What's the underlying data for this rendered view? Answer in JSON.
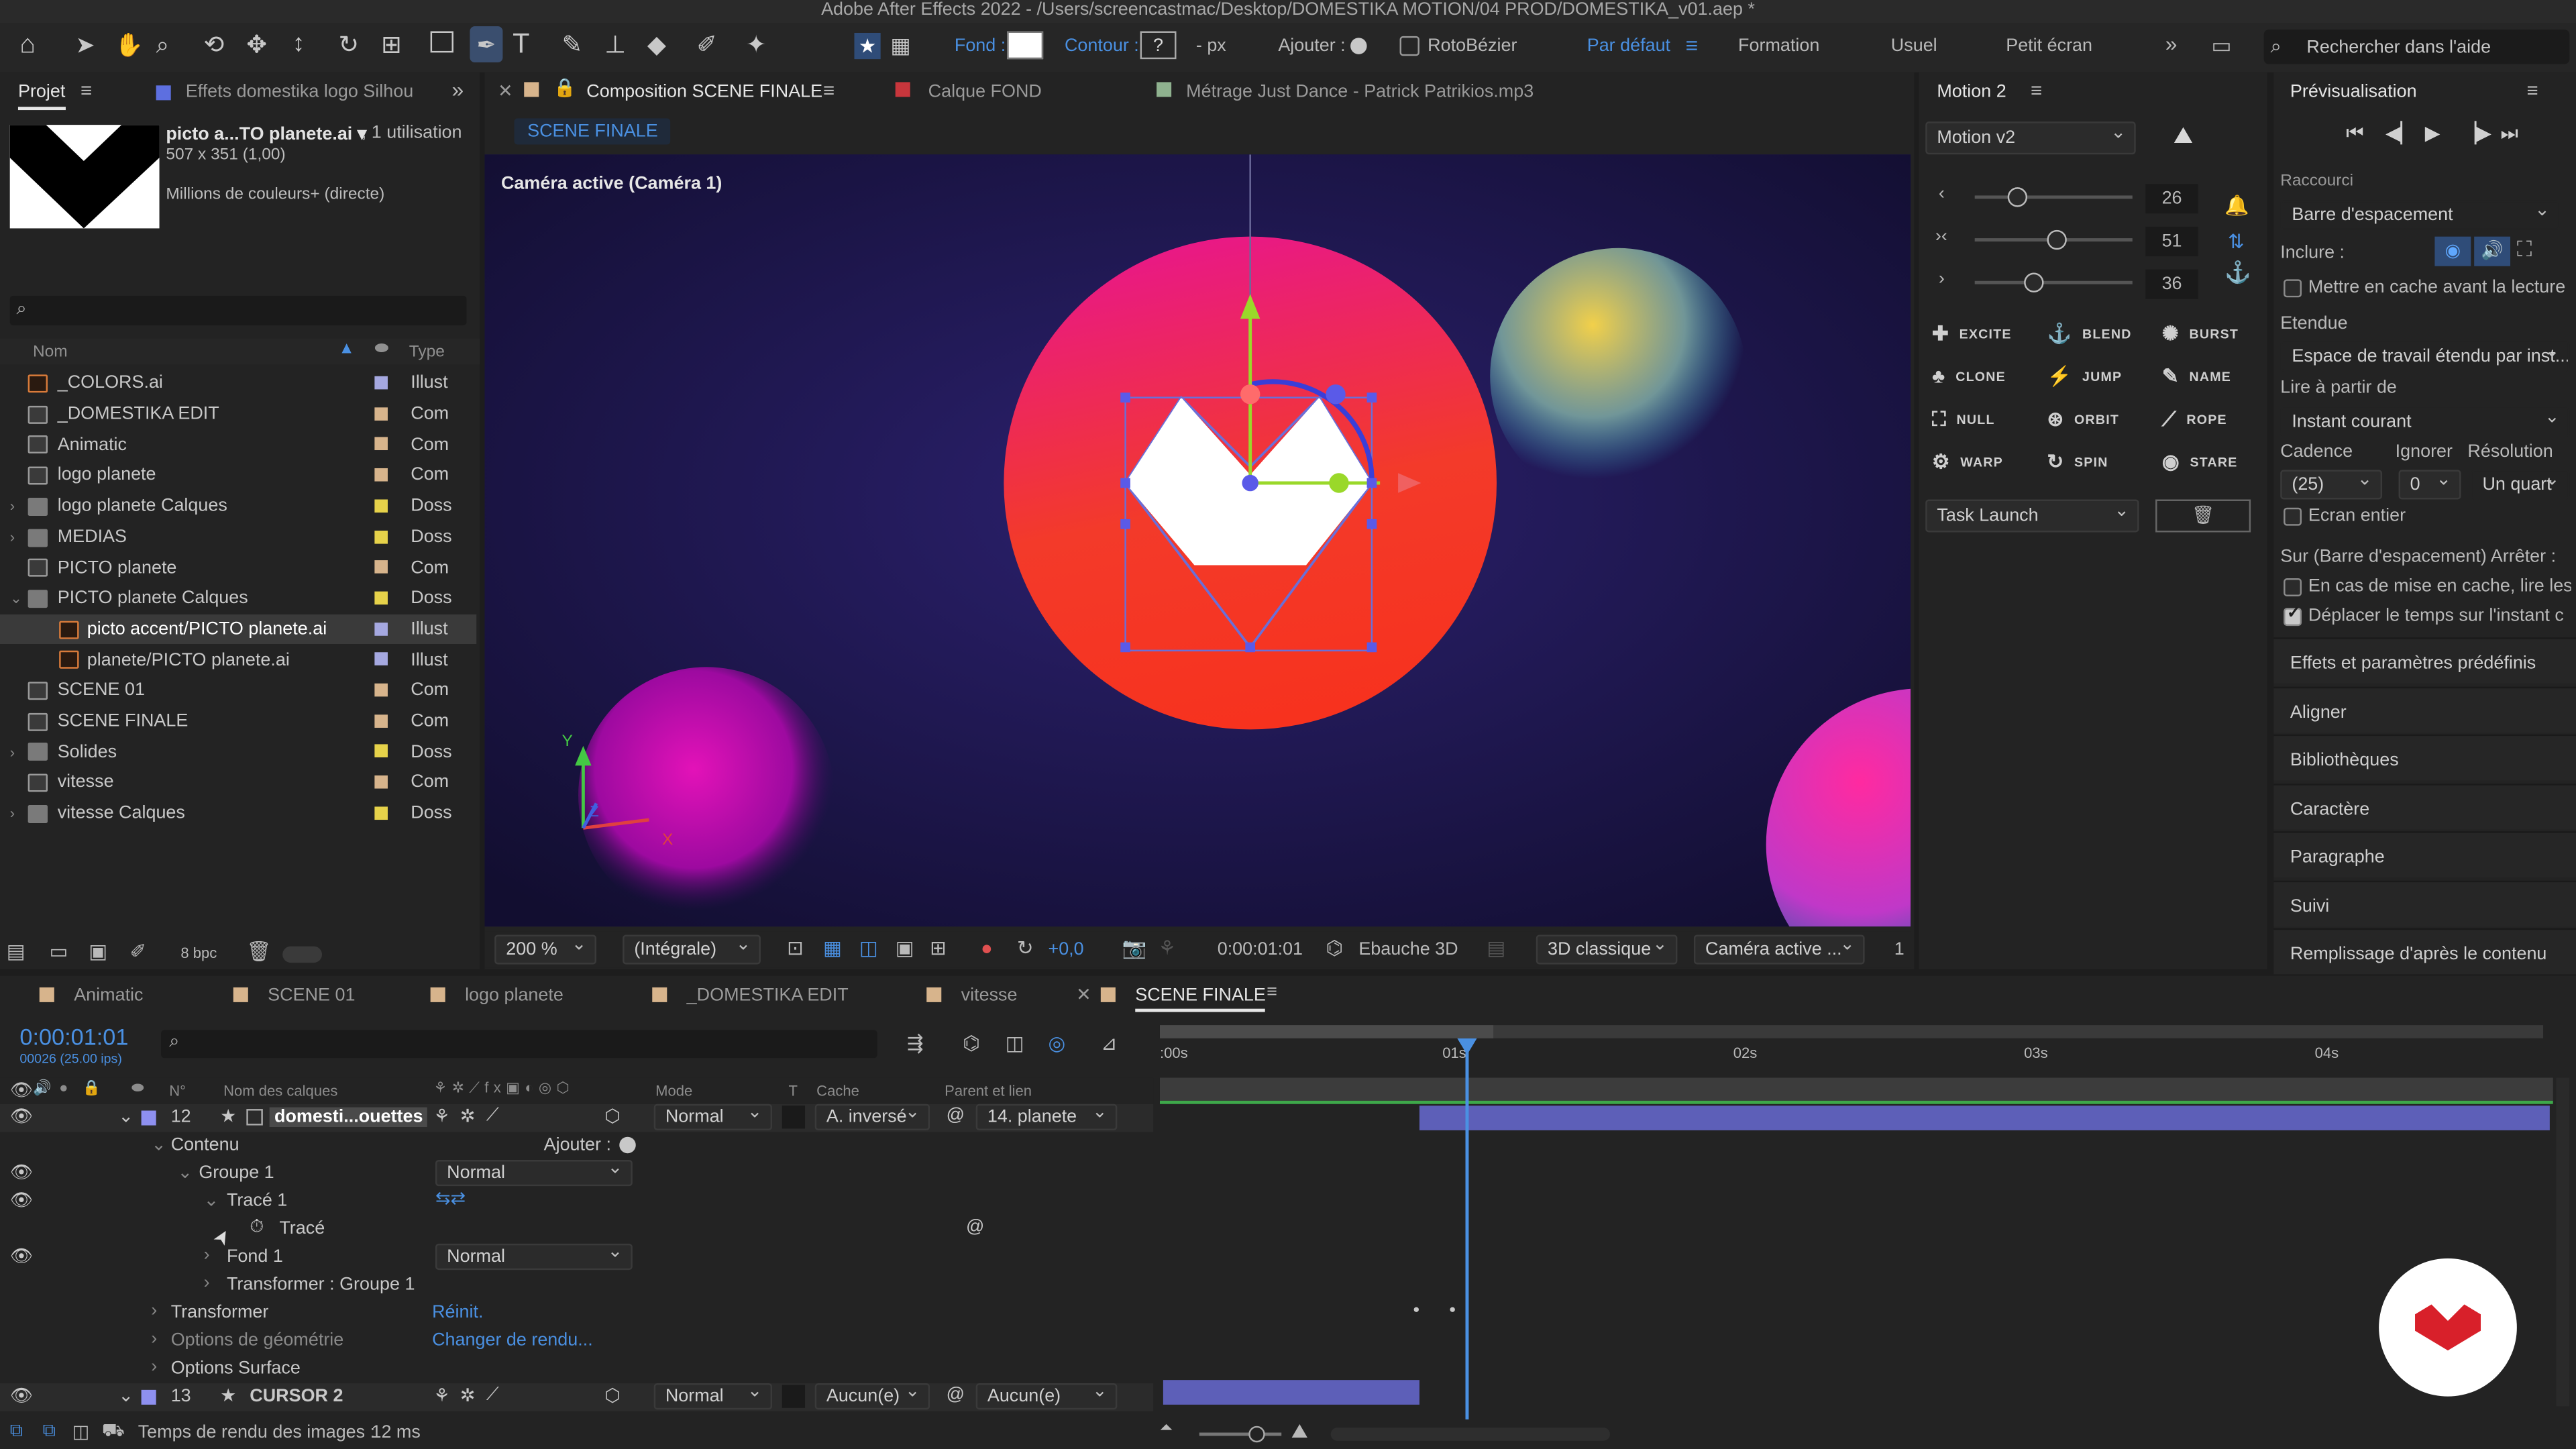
{
  "titlebar": {
    "title": "Adobe After Effects 2022 - /Users/screencastmac/Desktop/DOMESTIKA MOTION/04 PROD/DOMESTIKA_v01.aep *"
  },
  "toolbar": {
    "fill_label": "Fond :",
    "stroke_label": "Contour :",
    "stroke_value": "?",
    "px_label": "- px",
    "add_label": "Ajouter :",
    "roto_label": "RotoBézier",
    "workspaces": [
      "Par défaut",
      "Formation",
      "Usuel",
      "Petit écran"
    ],
    "search_placeholder": "Rechercher dans l'aide"
  },
  "project": {
    "tabs": [
      "Projet",
      "Effets  domestika logo Silhou"
    ],
    "preview_name": "picto a...TO planete.ai ▾",
    "preview_uses": ", 1 utilisation",
    "preview_dims": "507 x 351 (1,00)",
    "preview_colors": "Millions de couleurs+ (directe)",
    "col_name": "Nom",
    "col_type": "Type",
    "items": [
      {
        "name": "_COLORS.ai",
        "type": "Illust",
        "kind": "ai",
        "lab": "#a5a8e0",
        "tw": ""
      },
      {
        "name": "_DOMESTIKA EDIT",
        "type": "Com",
        "kind": "comp",
        "lab": "#d7b48c",
        "tw": ""
      },
      {
        "name": "Animatic",
        "type": "Com",
        "kind": "comp",
        "lab": "#d7b48c",
        "tw": ""
      },
      {
        "name": "logo planete",
        "type": "Com",
        "kind": "comp",
        "lab": "#d7b48c",
        "tw": ""
      },
      {
        "name": "logo planete Calques",
        "type": "Doss",
        "kind": "folder",
        "lab": "#e6d24a",
        "tw": "›"
      },
      {
        "name": "MEDIAS",
        "type": "Doss",
        "kind": "folder",
        "lab": "#e6d24a",
        "tw": "›"
      },
      {
        "name": "PICTO planete",
        "type": "Com",
        "kind": "comp",
        "lab": "#d7b48c",
        "tw": ""
      },
      {
        "name": "PICTO planete Calques",
        "type": "Doss",
        "kind": "folder",
        "lab": "#e6d24a",
        "tw": "⌄"
      },
      {
        "name": "picto accent/PICTO planete.ai",
        "type": "Illust",
        "kind": "ai",
        "lab": "#a5a8e0",
        "tw": "",
        "sel": true,
        "indent": true
      },
      {
        "name": "planete/PICTO planete.ai",
        "type": "Illust",
        "kind": "ai",
        "lab": "#a5a8e0",
        "tw": "",
        "indent": true
      },
      {
        "name": "SCENE 01",
        "type": "Com",
        "kind": "comp",
        "lab": "#d7b48c",
        "tw": ""
      },
      {
        "name": "SCENE FINALE",
        "type": "Com",
        "kind": "comp",
        "lab": "#d7b48c",
        "tw": ""
      },
      {
        "name": "Solides",
        "type": "Doss",
        "kind": "folder",
        "lab": "#e6d24a",
        "tw": "›"
      },
      {
        "name": "vitesse",
        "type": "Com",
        "kind": "comp",
        "lab": "#d7b48c",
        "tw": ""
      },
      {
        "name": "vitesse Calques",
        "type": "Doss",
        "kind": "folder",
        "lab": "#e6d24a",
        "tw": "›"
      }
    ],
    "bpc": "8 bpc"
  },
  "comp": {
    "tabs": [
      "Composition  SCENE FINALE",
      "Calque  FOND",
      "Métrage  Just Dance - Patrick Patrikios.mp3"
    ],
    "subtab": "SCENE FINALE",
    "camera_label": "Caméra active (Caméra 1)",
    "footer": {
      "zoom": "200 %",
      "resolution": "(Intégrale)",
      "exposure": "+0,0",
      "time": "0:00:01:01",
      "draft": "Ebauche 3D",
      "renderer": "3D classique",
      "camera": "Caméra active ...",
      "views": "1"
    }
  },
  "motion": {
    "title": "Motion 2",
    "preset": "Motion v2",
    "values": [
      "26",
      "51",
      "36"
    ],
    "buttons": [
      "EXCITE",
      "BLEND",
      "BURST",
      "CLONE",
      "JUMP",
      "NAME",
      "NULL",
      "ORBIT",
      "ROPE",
      "WARP",
      "SPIN",
      "STARE"
    ],
    "task": "Task Launch"
  },
  "preview": {
    "title": "Prévisualisation",
    "shortcut_label": "Raccourci",
    "shortcut_value": "Barre d'espacement",
    "include_label": "Inclure :",
    "cache_label": "Mettre en cache avant la lecture",
    "extent_label": "Etendue",
    "extent_value": "Espace de travail étendu par inst...",
    "play_from_label": "Lire à partir de",
    "play_from_value": "Instant courant",
    "rate_label": "Cadence",
    "skip_label": "Ignorer",
    "res_label": "Résolution",
    "rate_value": "(25)",
    "skip_value": "0",
    "res_value": "Un quart",
    "fullscreen_label": "Ecran entier",
    "stop_label": "Sur (Barre d'espacement) Arrêter :",
    "opt1": "En cas de mise en cache, lire les",
    "opt2": "Déplacer le temps sur l'instant c",
    "panels": [
      "Effets et paramètres prédéfinis",
      "Aligner",
      "Bibliothèques",
      "Caractère",
      "Paragraphe",
      "Suivi",
      "Remplissage d'après le contenu"
    ]
  },
  "timeline": {
    "tabs": [
      "Animatic",
      "SCENE 01",
      "logo planete",
      "_DOMESTIKA EDIT",
      "vitesse",
      "SCENE FINALE"
    ],
    "timecode": "0:00:01:01",
    "fps": "00026 (25.00 ips)",
    "cols": {
      "num": "N°",
      "name": "Nom des calques",
      "mode": "Mode",
      "t": "T",
      "cache": "Cache",
      "parent": "Parent et lien"
    },
    "ruler": [
      ":00s",
      "01s",
      "02s",
      "03s",
      "04s"
    ],
    "layer12": {
      "num": "12",
      "name": "domesti...ouettes",
      "mode": "Normal",
      "cache": "A. inversé",
      "parent": "14. planete"
    },
    "contenu": "Contenu",
    "ajouter": "Ajouter :",
    "groupe1": "Groupe 1",
    "groupe_mode": "Normal",
    "trace1": "Tracé 1",
    "trace": "Tracé",
    "fond1": "Fond 1",
    "fond_mode": "Normal",
    "transform_group": "Transformer : Groupe 1",
    "transformer": "Transformer",
    "reinit": "Réinit.",
    "geom": "Options de géométrie",
    "geom_val": "Changer de rendu...",
    "surface": "Options Surface",
    "layer13": {
      "num": "13",
      "name": "CURSOR 2",
      "mode": "Normal",
      "cache": "Aucun(e)",
      "parent": "Aucun(e)"
    },
    "status": "Temps de rendu des images :",
    "status_val": "12 ms"
  },
  "colors": {
    "accent": "#2d8ceb",
    "layer_bar": "#5d5fb8",
    "playhead": "#4a90e2"
  }
}
